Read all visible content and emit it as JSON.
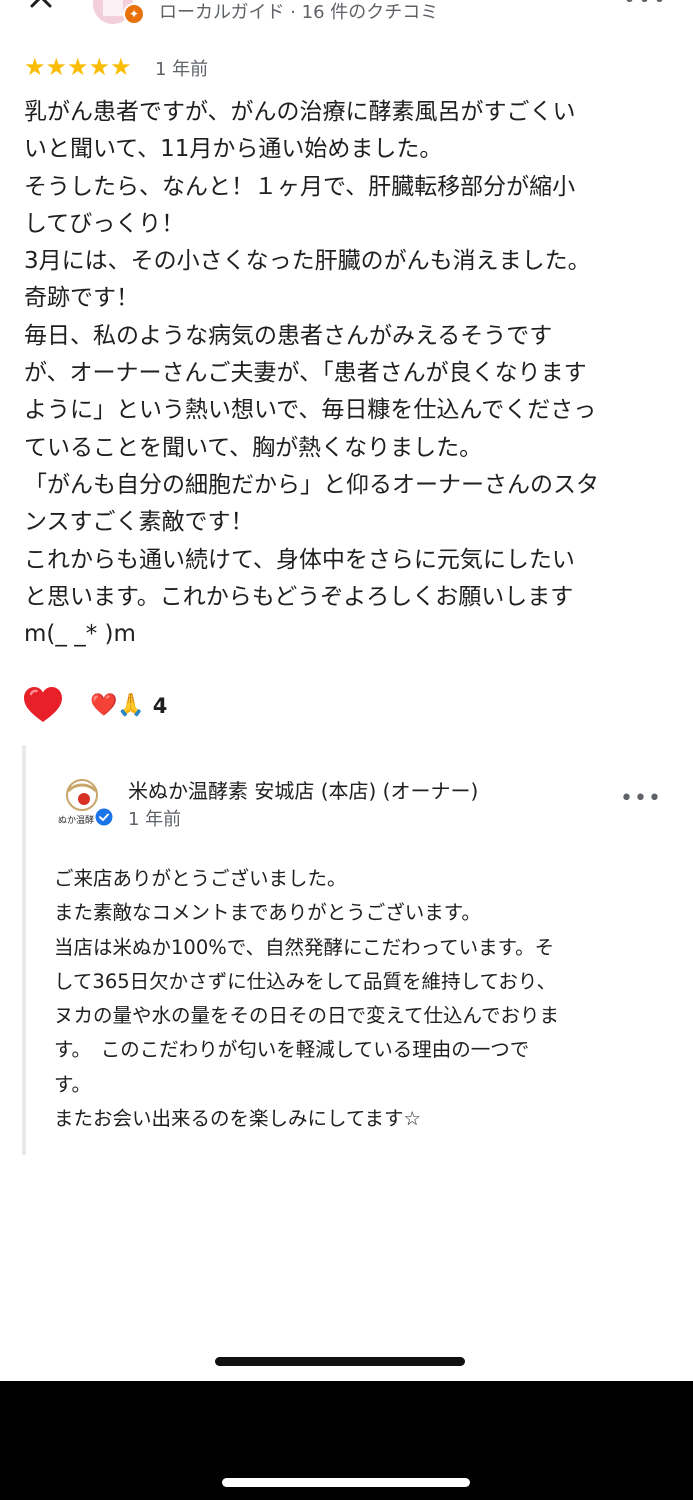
{
  "header": {
    "reviewer_meta": "ローカルガイド · 16 件のクチコミ",
    "more_icon": "more-horizontal-icon",
    "close_icon": "close-icon"
  },
  "review": {
    "stars": "★★★★★",
    "rating": 5,
    "time": "1 年前",
    "text": "乳がん患者ですが、がんの治療に酵素風呂がすごくい\nいと聞いて、11月から通い始めました。\nそうしたら、なんと！１ヶ月で、肝臓転移部分が縮小\nしてびっくり！\n3月には、その小さくなった肝臓のがんも消えました。\n奇跡です！\n毎日、私のような病気の患者さんがみえるそうです\nが、オーナーさんご夫妻が、「患者さんが良くなります\nように」という熱い想いで、毎日糠を仕込んでくださっ\nていることを聞いて、胸が熱くなりました。\n「がんも自分の細胞だから」と仰るオーナーさんのスタ\nンスすごく素敵です！\nこれからも通い続けて、身体中をさらに元気にしたい\nと思います。これからもどうぞよろしくお願いします\nm(_ _* )m",
    "reactions": {
      "emoji": "❤️🙏",
      "count": "4"
    }
  },
  "owner_reply": {
    "name": "米ぬか温酵素 安城店 (本店) (オーナー)",
    "time": "1 年前",
    "logo_text": "ぬか温酵",
    "text": "ご来店ありがとうございました。\nまた素敵なコメントまでありがとうございます。\n当店は米ぬか100%で、自然発酵にこだわっています。そ\nして365日欠かさずに仕込みをして品質を維持しており、\nヌカの量や水の量をその日その日で変えて仕込んでおりま\nす。　このこだわりが匂いを軽減している理由の一つで\nす。\nまたお会い出来るのを楽しみにしてます☆"
  },
  "colors": {
    "star": "#fbbc04",
    "heart": "#e8202a",
    "muted_text": "#5f6368",
    "local_guide_badge": "#e8710a",
    "verified": "#1a73e8"
  }
}
